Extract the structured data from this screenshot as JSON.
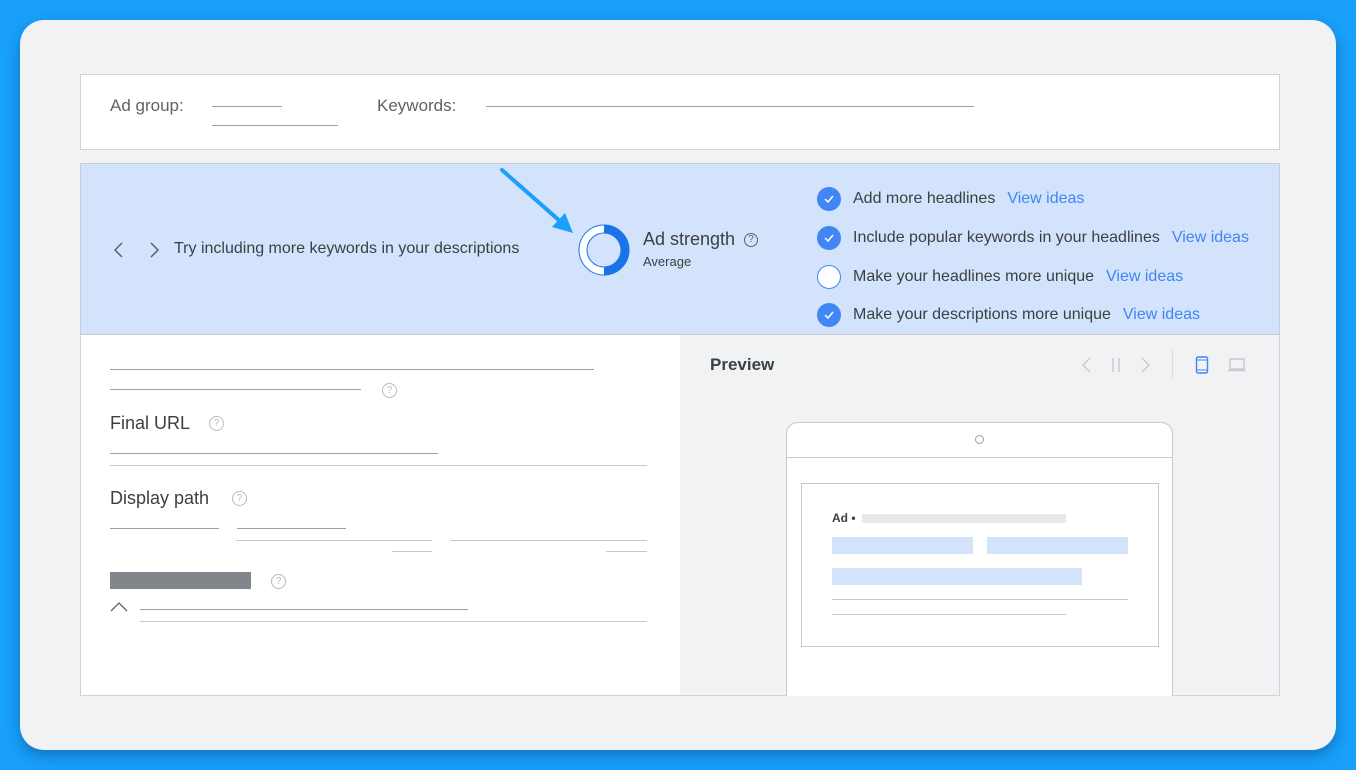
{
  "topbar": {
    "ad_group_label": "Ad group:",
    "keywords_label": "Keywords:"
  },
  "banner": {
    "prev_icon": "chevron-left-icon",
    "next_icon": "chevron-right-icon",
    "tip": "Try including more keywords in your descriptions",
    "ad_strength": {
      "title": "Ad strength",
      "help_icon": "?",
      "rating": "Average",
      "fill_fraction": 0.5,
      "color": "#1a73e8"
    },
    "checklist": [
      {
        "text": "Add more headlines",
        "checked": true,
        "link": "View ideas"
      },
      {
        "text": "Include popular keywords in your headlines",
        "checked": true,
        "link": "View ideas"
      },
      {
        "text": "Make your headlines more unique",
        "checked": false,
        "link": "View ideas"
      },
      {
        "text": "Make your descriptions more unique",
        "checked": true,
        "link": "View ideas"
      }
    ],
    "accent_color": "#4285f4",
    "annotation_arrow_color": "#18a0fb"
  },
  "form": {
    "final_url_label": "Final URL",
    "display_path_label": "Display path",
    "help_icon": "?"
  },
  "preview": {
    "title": "Preview",
    "ad_label": "Ad",
    "ad_dot": "•",
    "selected_device": "mobile"
  }
}
